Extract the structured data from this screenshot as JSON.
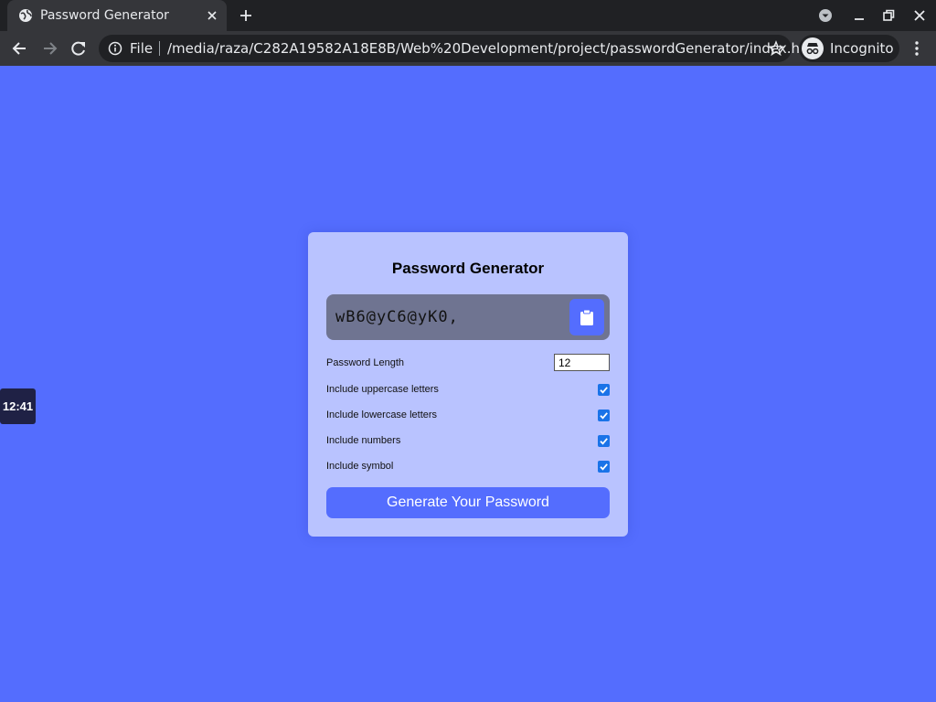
{
  "browser": {
    "tab_title": "Password Generator",
    "scheme_label": "File",
    "url": "/media/raza/C282A19582A18E8B/Web%20Development/project/passwordGenerator/index.html",
    "profile_label": "Incognito"
  },
  "clock": {
    "time": "12:41"
  },
  "app": {
    "title": "Password Generator",
    "password": "wB6@yC6@yK0,",
    "length_label": "Password Length",
    "length_value": "12",
    "options": [
      {
        "label": "Include uppercase letters",
        "checked": true
      },
      {
        "label": "Include lowercase letters",
        "checked": true
      },
      {
        "label": "Include numbers",
        "checked": true
      },
      {
        "label": "Include symbol",
        "checked": true
      }
    ],
    "generate_label": "Generate Your Password"
  },
  "icons": {
    "favicon": "globe-icon",
    "copy": "clipboard-icon",
    "info": "info-icon",
    "bookmark": "star-icon",
    "incognito": "incognito-icon"
  },
  "colors": {
    "page_background": "#546dfe",
    "card_background": "#b9c3ff",
    "result_background": "#6f7491",
    "accent": "#546dfe",
    "checkbox": "#1a73e8"
  }
}
